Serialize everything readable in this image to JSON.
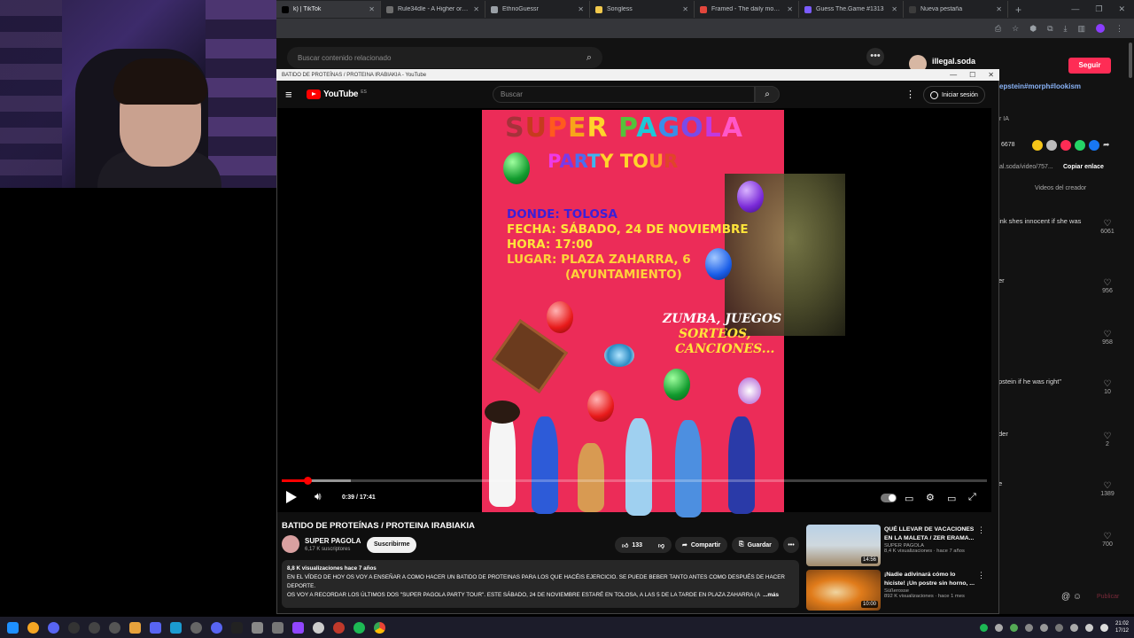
{
  "browser": {
    "tabs": [
      {
        "title": "k) | TikTok",
        "color": "#000000",
        "active": true
      },
      {
        "title": "Rule34dle - A Higher or Lower",
        "color": "#6d6d6d",
        "active": false
      },
      {
        "title": "EthnoGuessr",
        "color": "#9aa0a6",
        "active": false
      },
      {
        "title": "Songless",
        "color": "#f2c94c",
        "active": false
      },
      {
        "title": "Framed - The daily movie gues",
        "color": "#e2463c",
        "active": false
      },
      {
        "title": "Guess The.Game #1313",
        "color": "#7b5cff",
        "active": false
      },
      {
        "title": "Nueva pestaña",
        "color": "#3c3c3c",
        "active": false
      }
    ],
    "new_tab_icon": "+"
  },
  "tiktok": {
    "search_placeholder": "Buscar contenido relacionado",
    "username": "illegal.soda",
    "follow_label": "Seguir",
    "hashtags": "epstein#morph#lookism",
    "ai_label": "r IA",
    "likes_count": "6678",
    "link_text": "al.soda/video/757...",
    "copy_link_label": "Copiar enlace",
    "creator_videos_label": "Videos del creador",
    "comments": [
      {
        "text": "ink shes innocent if she was",
        "likes": "6061"
      },
      {
        "text": "er",
        "likes": "956"
      },
      {
        "text": "",
        "likes": "958"
      },
      {
        "text": "pstein if he was right\"",
        "likes": "10"
      },
      {
        "text": "der",
        "likes": "2"
      },
      {
        "text": "e",
        "likes": "1389"
      },
      {
        "text": "",
        "likes": "700"
      }
    ],
    "publish_label": "Publicar"
  },
  "popup": {
    "window_title": "BATIDO DE PROTEÍNAS / PROTEINA IRABIAKIA - YouTube"
  },
  "youtube": {
    "logo_text": "YouTube",
    "logo_country": "ES",
    "search_placeholder": "Buscar",
    "signin_label": "Iniciar sesión",
    "player": {
      "current_time": "0:39 / 17:41",
      "progress": 0.037,
      "poster": {
        "title_letters": [
          "S",
          "U",
          "P",
          "E",
          "R",
          " ",
          "P",
          "A",
          "G",
          "O",
          "L",
          "A"
        ],
        "title_colors": [
          "#a6323a",
          "#c63a1e",
          "#ff5a1e",
          "#f7a51a",
          "#ffd42a",
          "#ffffff",
          "#55c23a",
          "#1ec8d8",
          "#3a8ee8",
          "#7a4be8",
          "#c03ae0",
          "#ff57c8"
        ],
        "subtitle_letters": [
          "P",
          "A",
          "R",
          "T",
          "Y",
          " ",
          "T",
          "O",
          "U",
          "R"
        ],
        "subtitle_colors": [
          "#ee3ae8",
          "#7b3ae8",
          "#4a6ef0",
          "#3fb5f0",
          "#ffd42a",
          "#ffffff",
          "#ffd42a",
          "#ffd42a",
          "#ff9a2a",
          "#e0442a"
        ],
        "line1": {
          "key": "DONDE:",
          "value": "TOLOSA"
        },
        "line2": {
          "key": "FECHA:",
          "value": "SÁBADO, 24 DE NOVIEMBRE"
        },
        "line3": {
          "key": "HORA:",
          "value": "17:00"
        },
        "line4": {
          "key": "LUGAR:",
          "value": "PLAZA ZAHARRA, 6"
        },
        "line5": "(AYUNTAMIENTO)",
        "activities1": "ZUMBA, JUEGOS",
        "activities2": "SORTEOS,",
        "activities3": "CANCIONES..."
      }
    },
    "video": {
      "title": "BATIDO DE PROTEÍNAS / PROTEINA IRABIAKIA",
      "channel": "SUPER PAGOLA",
      "subscribers": "6,17 K suscriptores",
      "subscribe_label": "Suscribirme",
      "likes": "133",
      "share_label": "Compartir",
      "save_label": "Guardar",
      "views_line": "8,8 K visualizaciones  hace 7 años",
      "description_1": "EN EL VÍDEO DE HOY OS VOY A ENSEÑAR A COMO HACER UN BATIDO DE PROTEINAS PARA LOS QUE HACÉIS EJERCICIO. SE PUEDE BEBER TANTO ANTES COMO DESPUÉS DE HACER DEPORTE.",
      "description_2": "OS VOY A RECORDAR LOS ÚLTIMOS DOS \"SUPER PAGOLA PARTY TOUR\". ESTE SÁBADO, 24 DE NOVIEMBRE ESTARÉ EN TOLOSA, A LAS 5 DE LA TARDE EN PLAZA ZAHARRA (A",
      "more_label": "...más"
    },
    "recommendations": [
      {
        "title": "QUÉ LLEVAR DE VACACIONES EN LA MALETA / ZER ERAMA...",
        "channel": "SUPER PAGOLA",
        "meta": "8,4 K visualizaciones · hace 7 años",
        "duration": "14:56"
      },
      {
        "title": "¡Nadie adivinará cómo lo hiciste! ¡Un postre sin horno, ...",
        "channel": "Süßerosse",
        "meta": "892 K visualizaciones · hace 1 mes",
        "duration": "10:00"
      }
    ]
  },
  "taskbar": {
    "clock_time": "21:02",
    "clock_date": "17/12"
  }
}
